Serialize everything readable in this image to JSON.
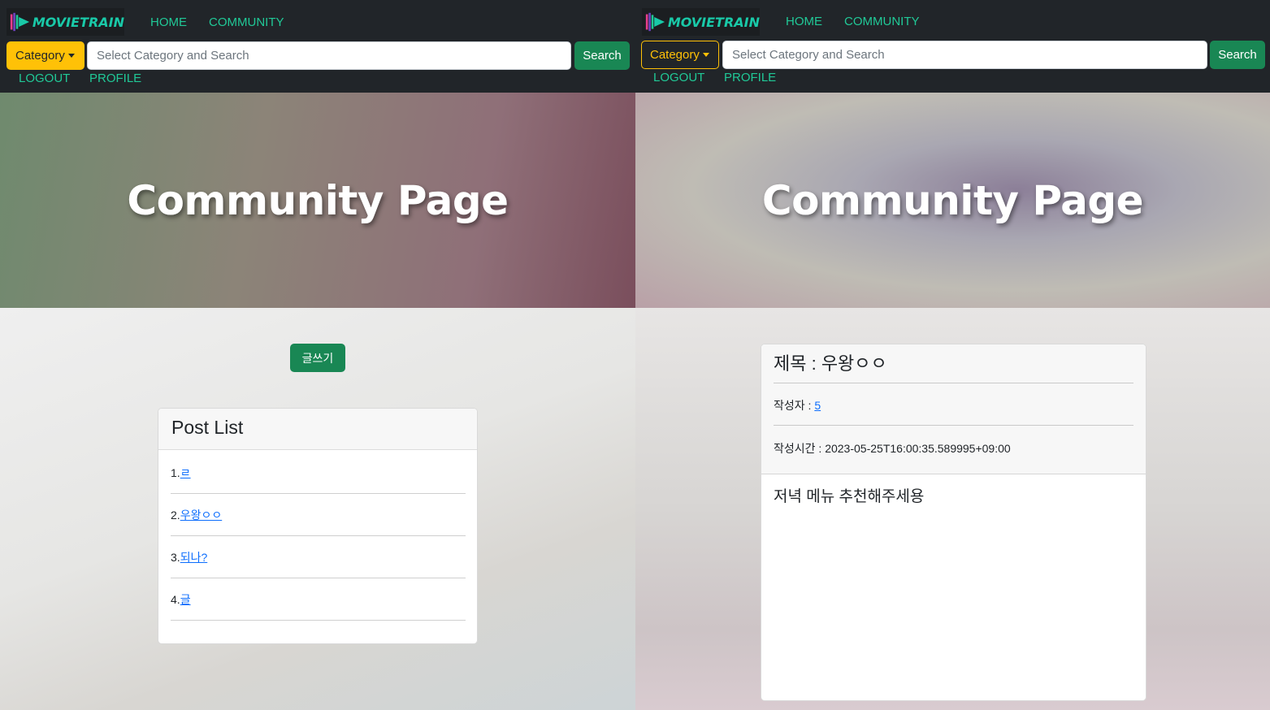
{
  "brand": {
    "name": "MOVIETRAIN"
  },
  "nav": {
    "home": "HOME",
    "community": "COMMUNITY",
    "logout": "LOGOUT",
    "profile": "PROFILE"
  },
  "search": {
    "category_label": "Category",
    "placeholder": "Select Category and Search",
    "button_label": "Search"
  },
  "hero": {
    "title": "Community Page"
  },
  "list_page": {
    "write_button": "글쓰기",
    "card_title": "Post List",
    "posts": [
      {
        "number": "1.",
        "title": " ㄹ"
      },
      {
        "number": "2.",
        "title": " 우왕ㅇㅇ"
      },
      {
        "number": "3.",
        "title": " 되나?"
      },
      {
        "number": "4.",
        "title": " 글"
      }
    ]
  },
  "detail_page": {
    "title": "제목 : 우왕ㅇㅇ",
    "author_label": "작성자 : ",
    "author_value": "5",
    "time_label": "작성시간 : ",
    "time_value": "2023-05-25T16:00:35.589995+09:00",
    "content": "저녁 메뉴 추천해주세용"
  },
  "colors": {
    "navbar": "#212529",
    "accent": "#20c997",
    "warning": "#ffc107",
    "success": "#198754",
    "link": "#0d6efd"
  }
}
